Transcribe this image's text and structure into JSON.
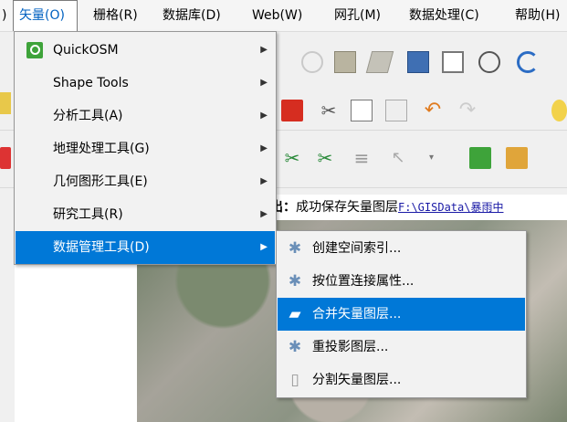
{
  "menubar": {
    "items": [
      {
        "label": ")"
      },
      {
        "label": "矢量(O)"
      },
      {
        "label": "栅格(R)"
      },
      {
        "label": "数据库(D)"
      },
      {
        "label": "Web(W)"
      },
      {
        "label": "网孔(M)"
      },
      {
        "label": "数据处理(C)"
      },
      {
        "label": "帮助(H)"
      }
    ]
  },
  "vector_menu": {
    "items": [
      {
        "label": "QuickOSM",
        "icon": "quickosm-icon"
      },
      {
        "label": "Shape Tools"
      },
      {
        "label": "分析工具(A)"
      },
      {
        "label": "地理处理工具(G)"
      },
      {
        "label": "几何图形工具(E)"
      },
      {
        "label": "研究工具(R)"
      },
      {
        "label": "数据管理工具(D)"
      }
    ],
    "highlighted_index": 6
  },
  "data_management_submenu": {
    "items": [
      {
        "label": "创建空间索引...",
        "icon": "gear-icon"
      },
      {
        "label": "按位置连接属性...",
        "icon": "gear-icon"
      },
      {
        "label": "合并矢量图层...",
        "icon": "merge-layers-icon"
      },
      {
        "label": "重投影图层...",
        "icon": "gear-icon"
      },
      {
        "label": "分割矢量图层...",
        "icon": "split-layer-icon"
      }
    ],
    "highlighted_index": 2
  },
  "status": {
    "prefix": "出：",
    "message": "成功保存矢量图层",
    "path": "F:\\GISData\\暴雨中"
  },
  "colors": {
    "menu_highlight": "#0078d7",
    "active_menu_text": "#0061c1"
  }
}
